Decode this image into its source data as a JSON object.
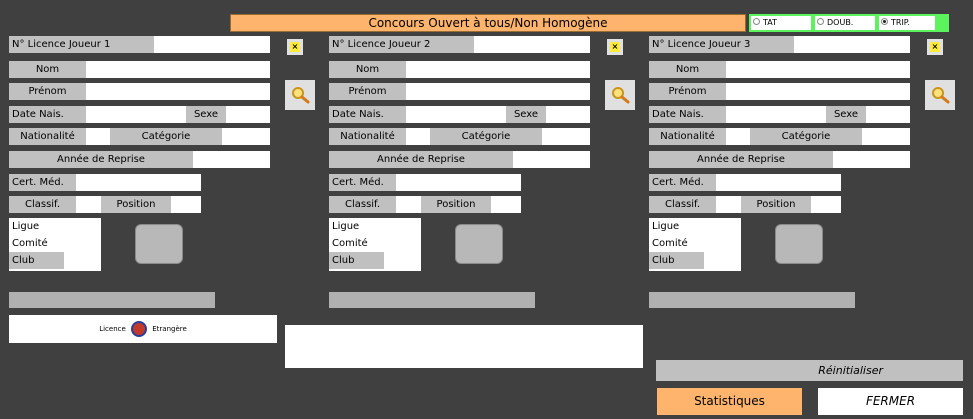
{
  "header": {
    "title": "Concours Ouvert à tous/Non Homogène",
    "radios": [
      {
        "label": "TAT",
        "checked": false
      },
      {
        "label": "DOUB.",
        "checked": false
      },
      {
        "label": "TRIP.",
        "checked": true
      }
    ]
  },
  "players": [
    {
      "licence_label": "N° Licence Joueur 1"
    },
    {
      "licence_label": "N° Licence Joueur 2"
    },
    {
      "licence_label": "N° Licence Joueur 3"
    }
  ],
  "fields": {
    "nom": "Nom",
    "prenom": "Prénom",
    "date_nais": "Date Nais.",
    "sexe": "Sexe",
    "nationalite": "Nationalité",
    "categorie": "Catégorie",
    "annee_reprise": "Année de Reprise",
    "cert_med": "Cert. Méd.",
    "classif": "Classif.",
    "position": "Position",
    "ligue": "Ligue",
    "comite": "Comité",
    "club": "Club"
  },
  "buttons": {
    "clear": "×",
    "licence_left": "Licence",
    "licence_right": "Etrangère",
    "reinit": "Réinitialiser",
    "stats": "Statistiques",
    "fermer": "FERMER"
  },
  "colors": {
    "background": "#404040",
    "label_grey": "#c0c0c0",
    "title_orange": "#ffb46e",
    "radio_green": "#5cf45c"
  }
}
